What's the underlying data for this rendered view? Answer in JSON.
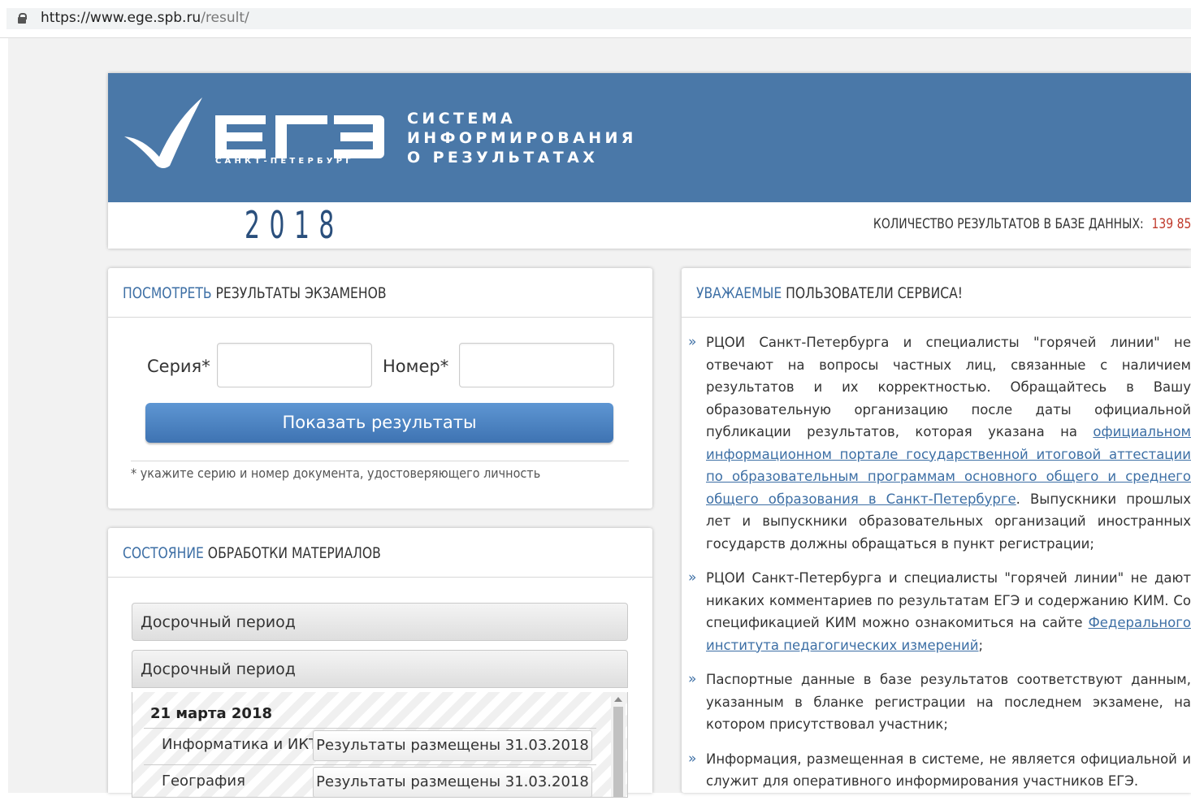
{
  "browser": {
    "url_host": "https://www.ege.spb.ru",
    "url_path": "/result/"
  },
  "header": {
    "logo_city": "САНКТ-ПЕТЕРБУРГ",
    "brand_line1": "СИСТЕМА",
    "brand_line2": "ИНФОРМИРОВАНИЯ",
    "brand_line3": "О РЕЗУЛЬТАТАХ",
    "year": "2018",
    "count_label": "КОЛИЧЕСТВО РЕЗУЛЬТАТОВ В БАЗЕ ДАННЫХ:",
    "count_value": "139 85",
    "colors": {
      "banner": "#4a78a8",
      "year": "#2a4f7c",
      "count": "#c0392b"
    }
  },
  "results_panel": {
    "title_highlight": "ПОСМОТРЕТЬ",
    "title_rest": "РЕЗУЛЬТАТЫ ЭКЗАМЕНОВ",
    "series_label": "Серия*",
    "series_value": "",
    "number_label": "Номер*",
    "number_value": "",
    "button_label": "Показать результаты",
    "note": "* укажите серию и номер документа, удостоверяющего личность"
  },
  "status_panel": {
    "title_highlight": "СОСТОЯНИЕ",
    "title_rest": "ОБРАБОТКИ МАТЕРИАЛОВ",
    "accordion_1": "Досрочный период",
    "accordion_2": "Досрочный период",
    "date": "21 марта 2018",
    "rows": [
      {
        "subject": "Информатика и ИКТ",
        "status": "Результаты размещены 31.03.2018"
      },
      {
        "subject": "География",
        "status": "Результаты размещены 31.03.2018"
      }
    ]
  },
  "notice_panel": {
    "title_highlight": "УВАЖАЕМЫЕ",
    "title_rest": "ПОЛЬЗОВАТЕЛИ СЕРВИСА!",
    "bullet": "»",
    "item1_text_a": "РЦОИ Санкт-Петербурга и специалисты \"горячей линии\" не отвечают на вопросы частных лиц, связанные с наличием результатов и их корректностью. Обращайтесь в Вашу образовательную организацию после даты официальной публикации результатов, которая указана на ",
    "item1_link": "официальном информационном портале государственной итоговой аттестации по образовательным программам основного общего и среднего общего образования в Санкт-Петербурге",
    "item1_text_b": ". Выпускники прошлых лет и выпускники образовательных организаций иностранных государств должны обращаться в пункт регистрации;",
    "item2_text_a": "РЦОИ Санкт-Петербурга и специалисты \"горячей линии\" не дают никаких комментариев по результатам ЕГЭ и содержанию КИМ. Со спецификацией КИМ можно ознакомиться на сайте ",
    "item2_link": "Федерального института педагогических измерений",
    "item2_text_b": ";",
    "item3_text": "Паспортные данные в базе результатов соответствуют данным, указанным в бланке регистрации на последнем экзамене, на котором присутствовал участник;",
    "item4_text": "Информация, размещенная в системе, не является официальной и служит для оперативного информирования участников ЕГЭ."
  }
}
